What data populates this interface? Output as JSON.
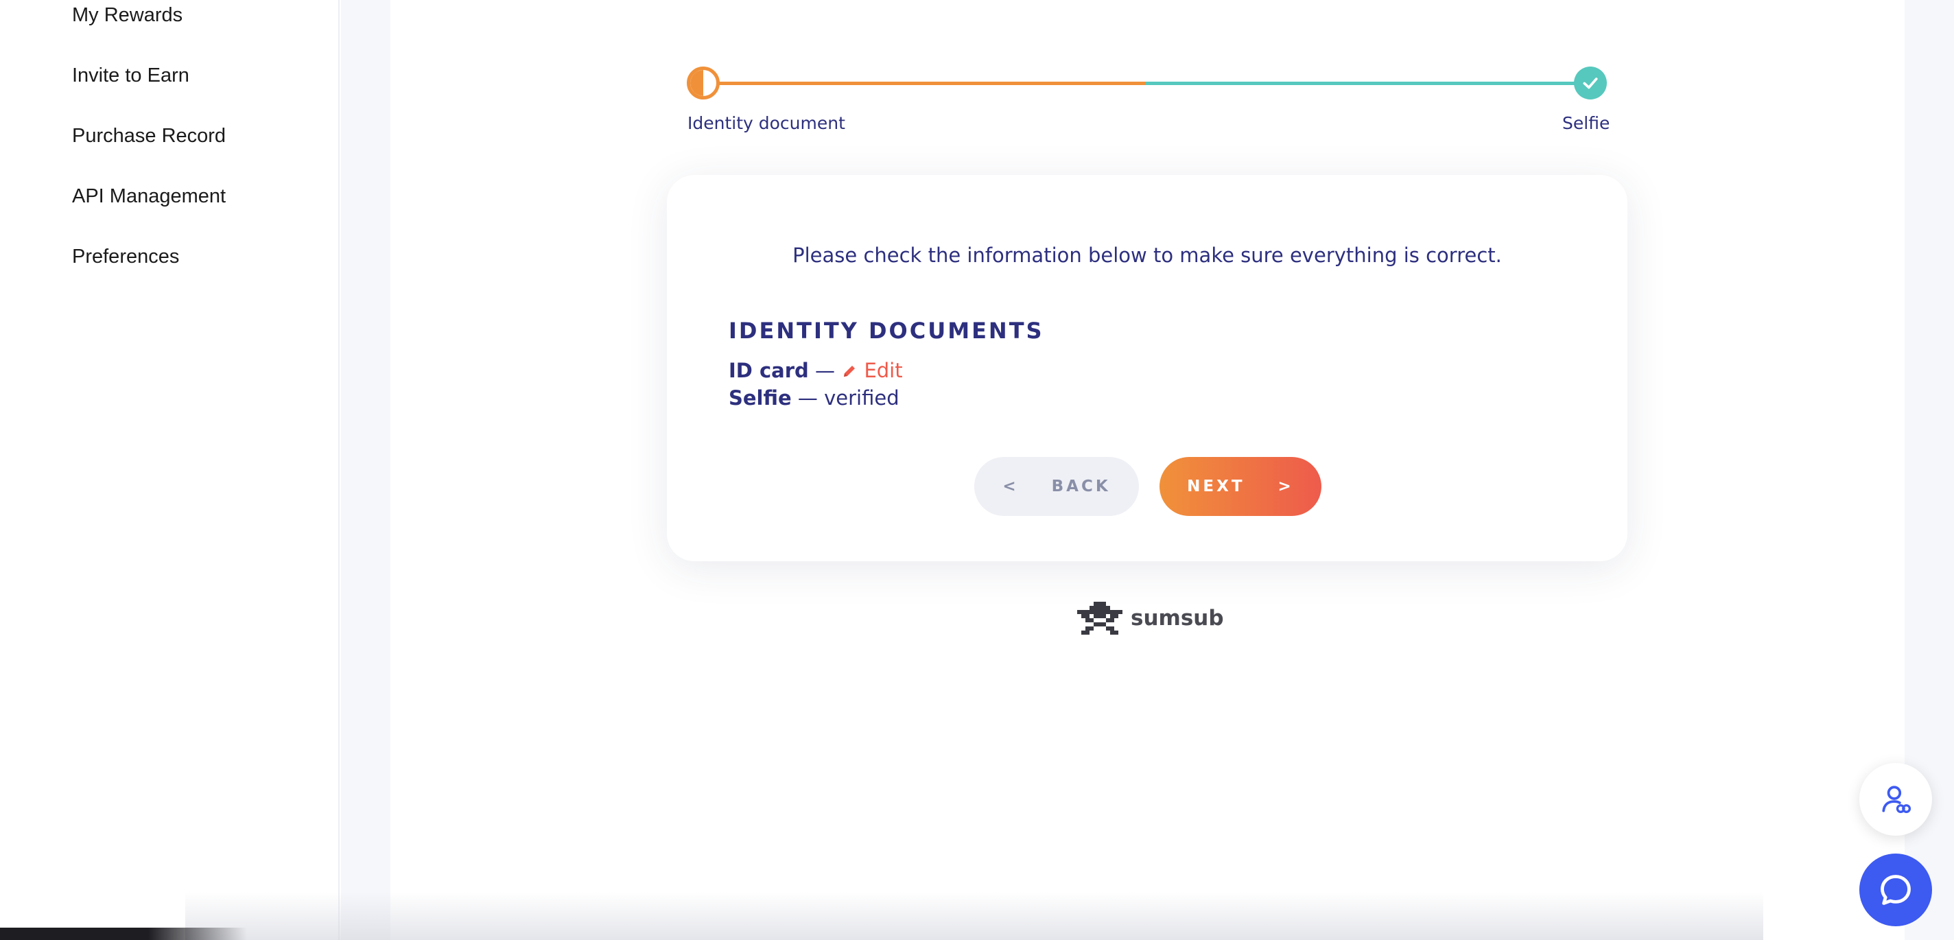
{
  "sidebar": {
    "items": [
      {
        "label": "My Rewards"
      },
      {
        "label": "Invite to Earn"
      },
      {
        "label": "Purchase Record"
      },
      {
        "label": "API Management"
      },
      {
        "label": "Preferences"
      }
    ]
  },
  "progress": {
    "steps": [
      {
        "label": "Identity document",
        "status": "in-progress"
      },
      {
        "label": "Selfie",
        "status": "done"
      }
    ],
    "accent_color": "#f0913a",
    "done_color": "#56c8bd"
  },
  "card": {
    "intro": "Please check the information below to make sure everything is correct.",
    "section_title": "IDENTITY DOCUMENTS",
    "documents": [
      {
        "name": "ID card",
        "separator": "—",
        "action": "Edit"
      },
      {
        "name": "Selfie",
        "separator": "—",
        "status": "verified"
      }
    ],
    "back_label": "BACK",
    "back_arrow": "<",
    "next_label": "NEXT",
    "next_arrow": ">"
  },
  "brand": {
    "name": "sumsub"
  },
  "colors": {
    "text_primary": "#2d2f7e",
    "edit": "#ef5a4a",
    "next_gradient_start": "#f0913a",
    "next_gradient_end": "#ee5b4c",
    "chat_button": "#3d5af1"
  },
  "icons": {
    "edit": "pencil-icon",
    "check": "check-icon",
    "support": "user-support-icon",
    "chat": "chat-bubble-icon"
  }
}
